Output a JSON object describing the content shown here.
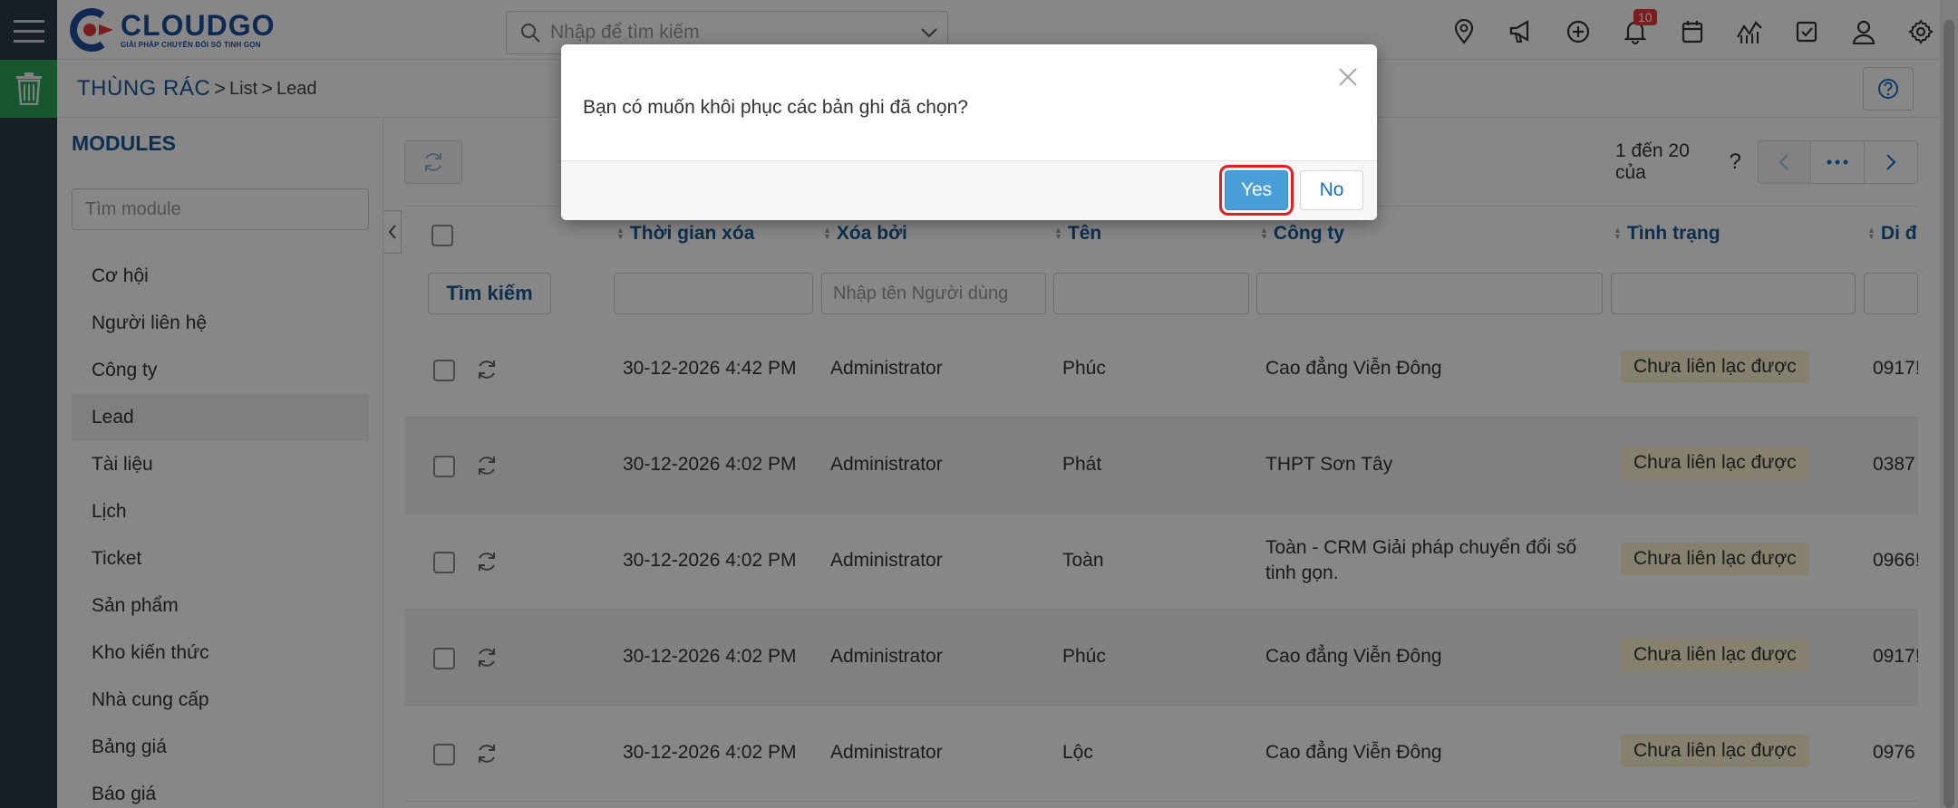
{
  "header": {
    "logo_title": "CLOUDGO",
    "logo_subtitle": "GIẢI PHÁP CHUYỂN ĐỔI SỐ TINH GỌN",
    "search_placeholder": "Nhập để tìm kiếm",
    "notification_count": "10",
    "icons": [
      "map-pin-icon",
      "megaphone-icon",
      "plus-circle-icon",
      "bell-icon",
      "calendar-icon",
      "chart-icon",
      "check-square-icon",
      "user-icon",
      "gear-icon"
    ]
  },
  "breadcrumb": {
    "main": "THÙNG RÁC",
    "sep": ">",
    "item1": "List",
    "item2": "Lead"
  },
  "modules": {
    "title": "MODULES",
    "search_placeholder": "Tìm module",
    "items": [
      {
        "label": "Cơ hội"
      },
      {
        "label": "Người liên hệ"
      },
      {
        "label": "Công ty"
      },
      {
        "label": "Lead"
      },
      {
        "label": "Tài liệu"
      },
      {
        "label": "Lịch"
      },
      {
        "label": "Ticket"
      },
      {
        "label": "Sản phẩm"
      },
      {
        "label": "Kho kiến thức"
      },
      {
        "label": "Nhà cung cấp"
      },
      {
        "label": "Bảng giá"
      },
      {
        "label": "Báo giá"
      }
    ],
    "active": "Lead"
  },
  "pager": {
    "text": "1 đến 20 của",
    "q": "?"
  },
  "table": {
    "columns": [
      "Thời gian xóa",
      "Xóa bởi",
      "Tên",
      "Công ty",
      "Tình trạng",
      "Di đ"
    ],
    "search_button": "Tìm kiếm",
    "user_filter_placeholder": "Nhập tên Người dùng",
    "rows": [
      {
        "time": "30-12-2026 4:42 PM",
        "by": "Administrator",
        "name": "Phúc",
        "company": "Cao đẳng Viễn Đông",
        "status": "Chưa liên lạc được",
        "phone": "0917!"
      },
      {
        "time": "30-12-2026 4:02 PM",
        "by": "Administrator",
        "name": "Phát",
        "company": "THPT Sơn Tây",
        "status": "Chưa liên lạc được",
        "phone": "0387"
      },
      {
        "time": "30-12-2026 4:02 PM",
        "by": "Administrator",
        "name": "Toàn",
        "company": "Toàn - CRM Giải pháp chuyển đổi số tinh gọn.",
        "status": "Chưa liên lạc được",
        "phone": "0966!"
      },
      {
        "time": "30-12-2026 4:02 PM",
        "by": "Administrator",
        "name": "Phúc",
        "company": "Cao đẳng Viễn Đông",
        "status": "Chưa liên lạc được",
        "phone": "0917!"
      },
      {
        "time": "30-12-2026 4:02 PM",
        "by": "Administrator",
        "name": "Lộc",
        "company": "Cao đẳng Viễn Đông",
        "status": "Chưa liên lạc được",
        "phone": "0976"
      }
    ]
  },
  "modal": {
    "message": "Bạn có muốn khôi phục các bản ghi đã chọn?",
    "yes": "Yes",
    "no": "No"
  },
  "colors": {
    "primary": "#1a5a96",
    "rail": "#2c3a47",
    "trash_green": "#2aa55a",
    "yes_button": "#4a9fd8",
    "status_pill": "#fbf3d0",
    "highlight": "#e02020"
  }
}
